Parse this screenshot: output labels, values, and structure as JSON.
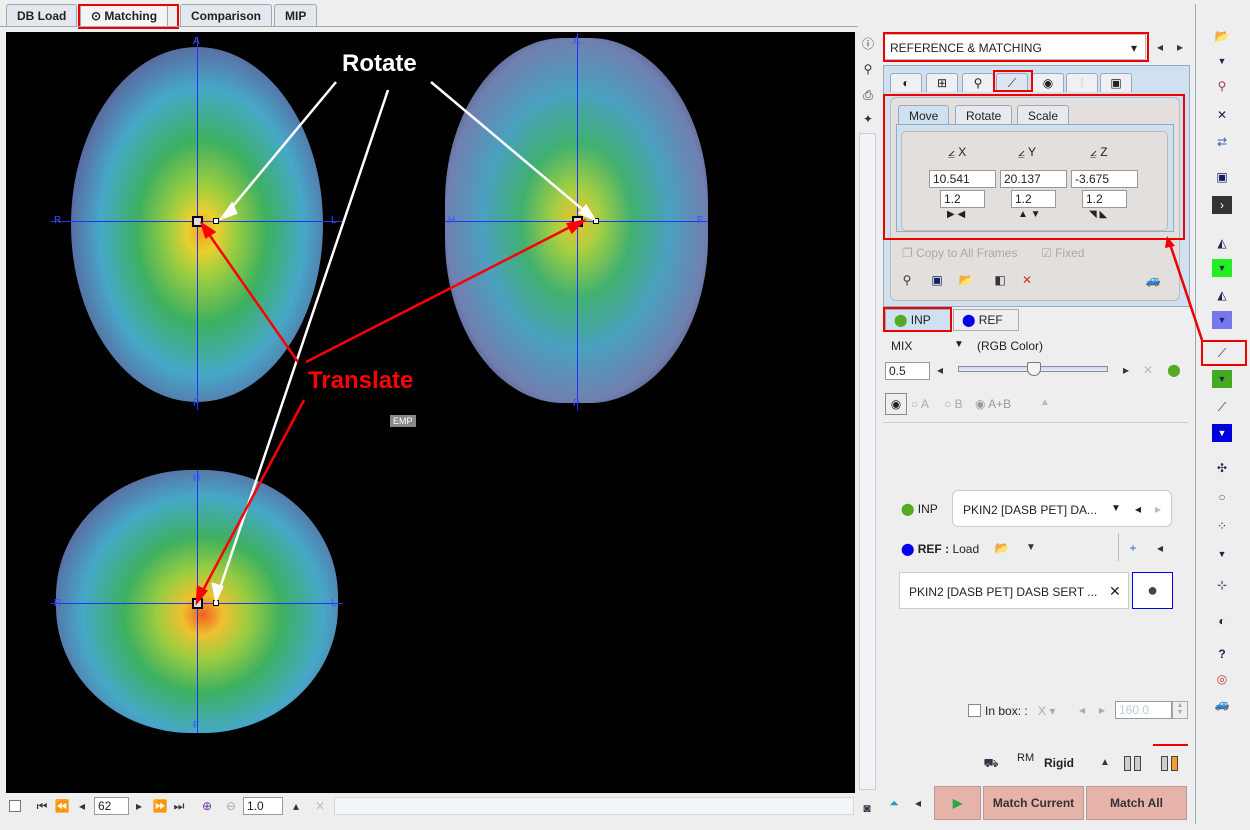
{
  "tabs": [
    {
      "label": "DB Load"
    },
    {
      "label": "Matching",
      "icon": "radio-icon"
    },
    {
      "label": "Comparison"
    },
    {
      "label": "MIP"
    }
  ],
  "viewer": {
    "axial": {
      "top": "A",
      "bottom": "P",
      "left": "R",
      "right": "L"
    },
    "sagittal": {
      "top": "A",
      "bottom": "P",
      "left": "H",
      "right": "F"
    },
    "coronal": {
      "top": "H",
      "bottom": "F",
      "left": "R",
      "right": "L"
    },
    "emp_label": "EMP",
    "annotations": {
      "rotate": "Rotate",
      "translate": "Translate"
    },
    "annotation_colors": {
      "rotate": "#ffffff",
      "translate": "#ff0000"
    }
  },
  "bottom_toolbar": {
    "slice": "62",
    "zoom": "1.0"
  },
  "panel": {
    "mode_select": "REFERENCE & MATCHING",
    "tool_tabs": [
      "contrast-icon",
      "layout-icon",
      "pin-icon",
      "matching-icon",
      "fusion-icon",
      "probe-icon",
      "save-icon"
    ],
    "transform_tabs": [
      "Move",
      "Rotate",
      "Scale"
    ],
    "axes": [
      {
        "label": "X",
        "value": "10.541",
        "step": "1.2"
      },
      {
        "label": "Y",
        "value": "20.137",
        "step": "1.2"
      },
      {
        "label": "Z",
        "value": "-3.675",
        "step": "1.2"
      }
    ],
    "copy_all_frames": "Copy to All Frames",
    "fixed_label": "Fixed",
    "fixed_checked": true,
    "inp_tab": "INP",
    "ref_tab": "REF",
    "mix_mode": "MIX",
    "color_mode": "(RGB Color)",
    "mix_value": "0.5",
    "mix_fraction": 0.5,
    "radio": {
      "a": "A",
      "b": "B",
      "ab": "A+B",
      "selected": "A+B"
    },
    "inp_label": "INP",
    "inp_series": "PKIN2 [DASB PET] DA...",
    "ref_label": "REF :",
    "ref_load": "Load",
    "ref_series": "PKIN2 [DASB PET] DASB SERT ...",
    "in_box_label": "In box: :",
    "in_box_axis": "X",
    "in_box_value": "160.0",
    "rigid_label": "Rigid",
    "rm_label": "RM",
    "match_current": "Match Current",
    "match_all": "Match All",
    "colors": {
      "inp": "#55aa22",
      "ref": "#0000ee",
      "buttons": "#e6b3a8"
    }
  }
}
